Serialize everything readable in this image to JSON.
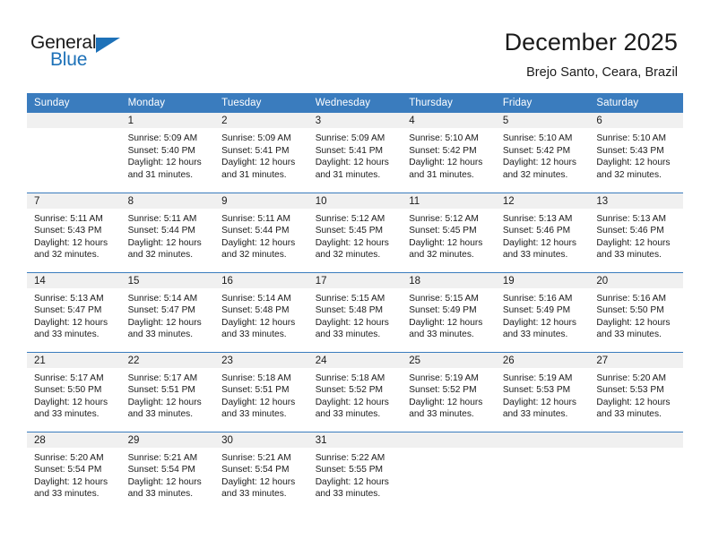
{
  "brand": {
    "name_part1": "General",
    "name_part2": "Blue",
    "logo_icon": "triangle-icon",
    "accent_color": "#1d71b8"
  },
  "header": {
    "title": "December 2025",
    "subtitle": "Brejo Santo, Ceara, Brazil"
  },
  "calendar": {
    "header_bg": "#3a7cbe",
    "daynum_bg": "#f0f0f0",
    "weekday_headers": [
      "Sunday",
      "Monday",
      "Tuesday",
      "Wednesday",
      "Thursday",
      "Friday",
      "Saturday"
    ],
    "weeks": [
      [
        {
          "day": "",
          "sunrise": "",
          "sunset": "",
          "daylight_line1": "",
          "daylight_line2": ""
        },
        {
          "day": "1",
          "sunrise": "Sunrise: 5:09 AM",
          "sunset": "Sunset: 5:40 PM",
          "daylight_line1": "Daylight: 12 hours",
          "daylight_line2": "and 31 minutes."
        },
        {
          "day": "2",
          "sunrise": "Sunrise: 5:09 AM",
          "sunset": "Sunset: 5:41 PM",
          "daylight_line1": "Daylight: 12 hours",
          "daylight_line2": "and 31 minutes."
        },
        {
          "day": "3",
          "sunrise": "Sunrise: 5:09 AM",
          "sunset": "Sunset: 5:41 PM",
          "daylight_line1": "Daylight: 12 hours",
          "daylight_line2": "and 31 minutes."
        },
        {
          "day": "4",
          "sunrise": "Sunrise: 5:10 AM",
          "sunset": "Sunset: 5:42 PM",
          "daylight_line1": "Daylight: 12 hours",
          "daylight_line2": "and 31 minutes."
        },
        {
          "day": "5",
          "sunrise": "Sunrise: 5:10 AM",
          "sunset": "Sunset: 5:42 PM",
          "daylight_line1": "Daylight: 12 hours",
          "daylight_line2": "and 32 minutes."
        },
        {
          "day": "6",
          "sunrise": "Sunrise: 5:10 AM",
          "sunset": "Sunset: 5:43 PM",
          "daylight_line1": "Daylight: 12 hours",
          "daylight_line2": "and 32 minutes."
        }
      ],
      [
        {
          "day": "7",
          "sunrise": "Sunrise: 5:11 AM",
          "sunset": "Sunset: 5:43 PM",
          "daylight_line1": "Daylight: 12 hours",
          "daylight_line2": "and 32 minutes."
        },
        {
          "day": "8",
          "sunrise": "Sunrise: 5:11 AM",
          "sunset": "Sunset: 5:44 PM",
          "daylight_line1": "Daylight: 12 hours",
          "daylight_line2": "and 32 minutes."
        },
        {
          "day": "9",
          "sunrise": "Sunrise: 5:11 AM",
          "sunset": "Sunset: 5:44 PM",
          "daylight_line1": "Daylight: 12 hours",
          "daylight_line2": "and 32 minutes."
        },
        {
          "day": "10",
          "sunrise": "Sunrise: 5:12 AM",
          "sunset": "Sunset: 5:45 PM",
          "daylight_line1": "Daylight: 12 hours",
          "daylight_line2": "and 32 minutes."
        },
        {
          "day": "11",
          "sunrise": "Sunrise: 5:12 AM",
          "sunset": "Sunset: 5:45 PM",
          "daylight_line1": "Daylight: 12 hours",
          "daylight_line2": "and 32 minutes."
        },
        {
          "day": "12",
          "sunrise": "Sunrise: 5:13 AM",
          "sunset": "Sunset: 5:46 PM",
          "daylight_line1": "Daylight: 12 hours",
          "daylight_line2": "and 33 minutes."
        },
        {
          "day": "13",
          "sunrise": "Sunrise: 5:13 AM",
          "sunset": "Sunset: 5:46 PM",
          "daylight_line1": "Daylight: 12 hours",
          "daylight_line2": "and 33 minutes."
        }
      ],
      [
        {
          "day": "14",
          "sunrise": "Sunrise: 5:13 AM",
          "sunset": "Sunset: 5:47 PM",
          "daylight_line1": "Daylight: 12 hours",
          "daylight_line2": "and 33 minutes."
        },
        {
          "day": "15",
          "sunrise": "Sunrise: 5:14 AM",
          "sunset": "Sunset: 5:47 PM",
          "daylight_line1": "Daylight: 12 hours",
          "daylight_line2": "and 33 minutes."
        },
        {
          "day": "16",
          "sunrise": "Sunrise: 5:14 AM",
          "sunset": "Sunset: 5:48 PM",
          "daylight_line1": "Daylight: 12 hours",
          "daylight_line2": "and 33 minutes."
        },
        {
          "day": "17",
          "sunrise": "Sunrise: 5:15 AM",
          "sunset": "Sunset: 5:48 PM",
          "daylight_line1": "Daylight: 12 hours",
          "daylight_line2": "and 33 minutes."
        },
        {
          "day": "18",
          "sunrise": "Sunrise: 5:15 AM",
          "sunset": "Sunset: 5:49 PM",
          "daylight_line1": "Daylight: 12 hours",
          "daylight_line2": "and 33 minutes."
        },
        {
          "day": "19",
          "sunrise": "Sunrise: 5:16 AM",
          "sunset": "Sunset: 5:49 PM",
          "daylight_line1": "Daylight: 12 hours",
          "daylight_line2": "and 33 minutes."
        },
        {
          "day": "20",
          "sunrise": "Sunrise: 5:16 AM",
          "sunset": "Sunset: 5:50 PM",
          "daylight_line1": "Daylight: 12 hours",
          "daylight_line2": "and 33 minutes."
        }
      ],
      [
        {
          "day": "21",
          "sunrise": "Sunrise: 5:17 AM",
          "sunset": "Sunset: 5:50 PM",
          "daylight_line1": "Daylight: 12 hours",
          "daylight_line2": "and 33 minutes."
        },
        {
          "day": "22",
          "sunrise": "Sunrise: 5:17 AM",
          "sunset": "Sunset: 5:51 PM",
          "daylight_line1": "Daylight: 12 hours",
          "daylight_line2": "and 33 minutes."
        },
        {
          "day": "23",
          "sunrise": "Sunrise: 5:18 AM",
          "sunset": "Sunset: 5:51 PM",
          "daylight_line1": "Daylight: 12 hours",
          "daylight_line2": "and 33 minutes."
        },
        {
          "day": "24",
          "sunrise": "Sunrise: 5:18 AM",
          "sunset": "Sunset: 5:52 PM",
          "daylight_line1": "Daylight: 12 hours",
          "daylight_line2": "and 33 minutes."
        },
        {
          "day": "25",
          "sunrise": "Sunrise: 5:19 AM",
          "sunset": "Sunset: 5:52 PM",
          "daylight_line1": "Daylight: 12 hours",
          "daylight_line2": "and 33 minutes."
        },
        {
          "day": "26",
          "sunrise": "Sunrise: 5:19 AM",
          "sunset": "Sunset: 5:53 PM",
          "daylight_line1": "Daylight: 12 hours",
          "daylight_line2": "and 33 minutes."
        },
        {
          "day": "27",
          "sunrise": "Sunrise: 5:20 AM",
          "sunset": "Sunset: 5:53 PM",
          "daylight_line1": "Daylight: 12 hours",
          "daylight_line2": "and 33 minutes."
        }
      ],
      [
        {
          "day": "28",
          "sunrise": "Sunrise: 5:20 AM",
          "sunset": "Sunset: 5:54 PM",
          "daylight_line1": "Daylight: 12 hours",
          "daylight_line2": "and 33 minutes."
        },
        {
          "day": "29",
          "sunrise": "Sunrise: 5:21 AM",
          "sunset": "Sunset: 5:54 PM",
          "daylight_line1": "Daylight: 12 hours",
          "daylight_line2": "and 33 minutes."
        },
        {
          "day": "30",
          "sunrise": "Sunrise: 5:21 AM",
          "sunset": "Sunset: 5:54 PM",
          "daylight_line1": "Daylight: 12 hours",
          "daylight_line2": "and 33 minutes."
        },
        {
          "day": "31",
          "sunrise": "Sunrise: 5:22 AM",
          "sunset": "Sunset: 5:55 PM",
          "daylight_line1": "Daylight: 12 hours",
          "daylight_line2": "and 33 minutes."
        },
        {
          "day": "",
          "sunrise": "",
          "sunset": "",
          "daylight_line1": "",
          "daylight_line2": ""
        },
        {
          "day": "",
          "sunrise": "",
          "sunset": "",
          "daylight_line1": "",
          "daylight_line2": ""
        },
        {
          "day": "",
          "sunrise": "",
          "sunset": "",
          "daylight_line1": "",
          "daylight_line2": ""
        }
      ]
    ]
  }
}
